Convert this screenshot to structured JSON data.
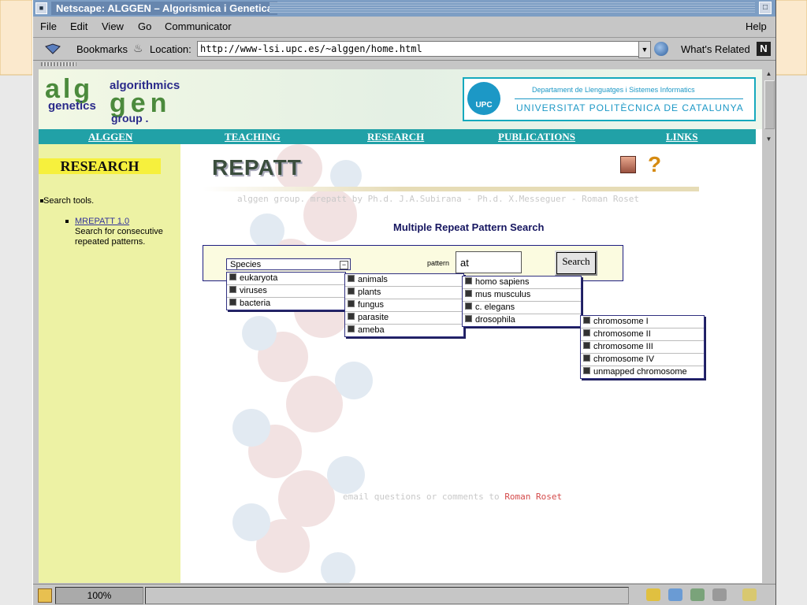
{
  "window": {
    "title": "Netscape: ALGGEN – Algorismica i Genetica"
  },
  "menu": [
    "File",
    "Edit",
    "View",
    "Go",
    "Communicator",
    "Help"
  ],
  "toolbar": {
    "bookmarks_label": "Bookmarks",
    "location_label": "Location:",
    "url": "http://www-lsi.upc.es/~alggen/home.html",
    "whats_related": "What's Related"
  },
  "header": {
    "logo_alg": "alg",
    "logo_gen": "gen",
    "logo_algorithmics": "algorithmics",
    "logo_genetics": "genetics",
    "logo_group": "group .",
    "upc_abbr": "UPC",
    "upc_dept": "Departament de Llenguatges i Sistemes Informatics",
    "upc_uni": "UNIVERSITAT POLITÈCNICA DE CATALUNYA"
  },
  "nav": [
    "ALGGEN",
    "TEACHING",
    "RESEARCH",
    "PUBLICATIONS",
    "LINKS"
  ],
  "sidebar": {
    "title": "RESEARCH",
    "item": "Search tools.",
    "sublink": "MREPATT 1.0",
    "subtext": "Search for consecutive repeated patterns."
  },
  "main": {
    "title": "REPATT",
    "credits": "alggen group. mrepatt by Ph.d. J.A.Subirana - Ph.d. X.Messeguer - Roman Roset",
    "subtitle": "Multiple Repeat Pattern Search",
    "pattern_label": "pattern",
    "pattern_value": "at",
    "search_label": "Search",
    "species_label": "Species",
    "species_toggle": "−",
    "level1": [
      "eukaryota",
      "viruses",
      "bacteria"
    ],
    "level2": [
      "animals",
      "plants",
      "fungus",
      "parasite",
      "ameba"
    ],
    "level3": [
      "homo sapiens",
      "mus musculus",
      "c. elegans",
      "drosophila"
    ],
    "level4": [
      "chromosome I",
      "chromosome II",
      "chromosome III",
      "chromosome IV",
      "unmapped chromosome"
    ],
    "email_text": "email questions or comments to ",
    "email_link": "Roman Roset"
  },
  "status": {
    "progress": "100%"
  }
}
